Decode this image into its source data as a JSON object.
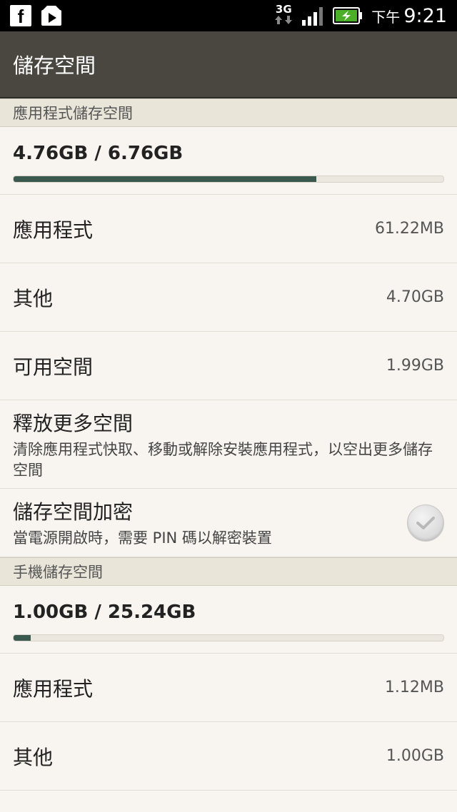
{
  "status_bar": {
    "facebook_icon_glyph": "f",
    "network_type": "3G",
    "time_ampm": "下午",
    "time": "9:21"
  },
  "header": {
    "title": "儲存空間"
  },
  "app_storage": {
    "section_title": "應用程式儲存空間",
    "usage_text": "4.76GB / 6.76GB",
    "usage_fraction": 0.704,
    "rows": [
      {
        "label": "應用程式",
        "value": "61.22MB"
      },
      {
        "label": "其他",
        "value": "4.70GB"
      },
      {
        "label": "可用空間",
        "value": "1.99GB"
      }
    ],
    "free_more": {
      "title": "釋放更多空間",
      "subtitle": "清除應用程式快取、移動或解除安裝應用程式，以空出更多儲存空間"
    },
    "encrypt": {
      "title": "儲存空間加密",
      "subtitle": "當電源開啟時，需要 PIN 碼以解密裝置"
    }
  },
  "phone_storage": {
    "section_title": "手機儲存空間",
    "usage_text": "1.00GB / 25.24GB",
    "usage_fraction": 0.04,
    "rows": [
      {
        "label": "應用程式",
        "value": "1.12MB"
      },
      {
        "label": "其他",
        "value": "1.00GB"
      }
    ]
  },
  "colors": {
    "progress_fill": "#3b5a4f",
    "header_bg": "#4a4741",
    "section_bg": "#e9e5d9",
    "list_bg": "#f8f4ef"
  }
}
